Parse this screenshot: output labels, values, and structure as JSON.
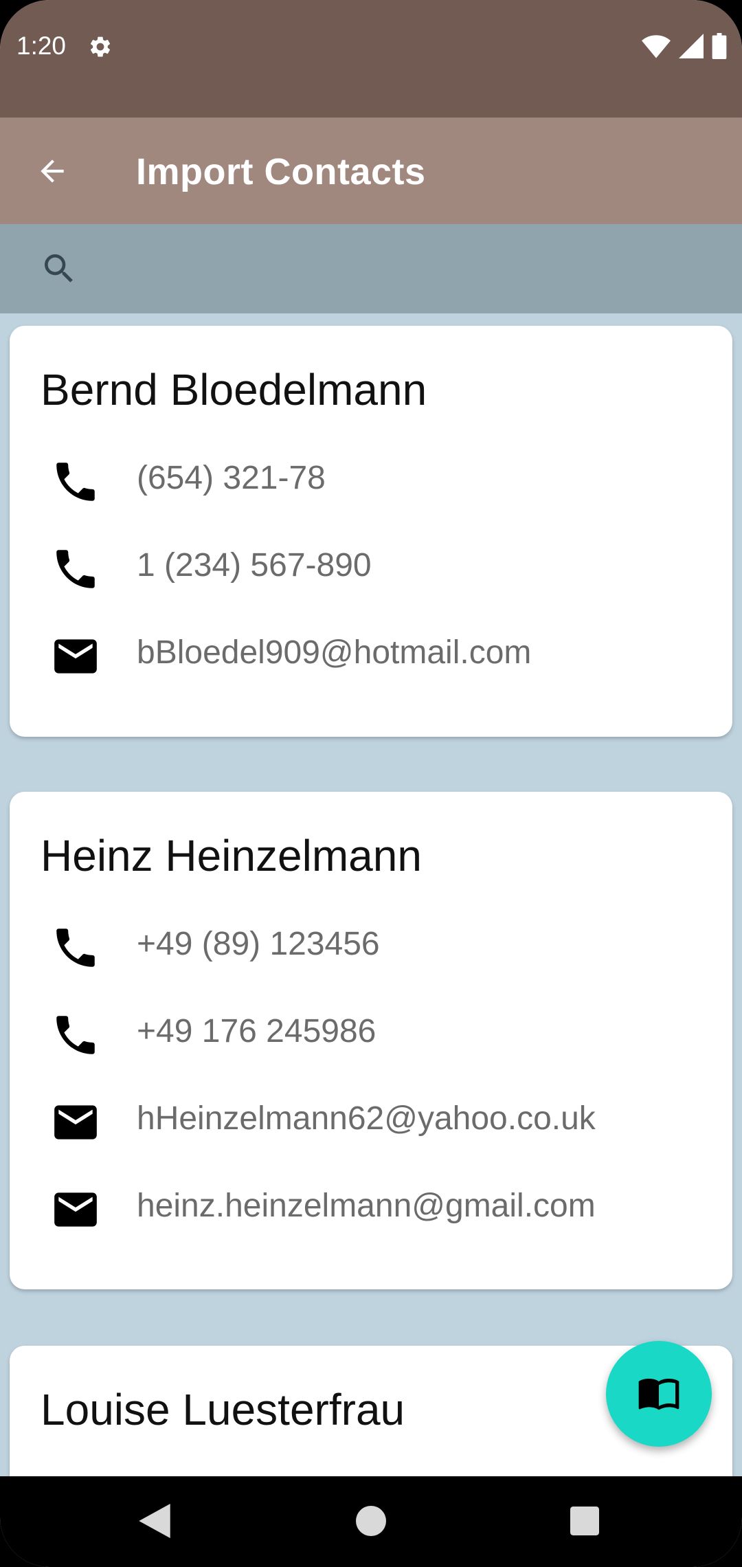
{
  "status_bar": {
    "time": "1:20",
    "icons": [
      "gear-icon",
      "wifi-icon",
      "signal-icon",
      "battery-icon"
    ]
  },
  "app_bar": {
    "title": "Import Contacts",
    "back_icon": "arrow-back-icon"
  },
  "search": {
    "icon": "search-icon",
    "value": "",
    "placeholder": ""
  },
  "contacts": [
    {
      "name": "Bernd Bloedelmann",
      "entries": [
        {
          "type": "phone",
          "value": "(654) 321-78"
        },
        {
          "type": "phone",
          "value": "1 (234) 567-890"
        },
        {
          "type": "email",
          "value": "bBloedel909@hotmail.com"
        }
      ]
    },
    {
      "name": "Heinz Heinzelmann",
      "entries": [
        {
          "type": "phone",
          "value": "+49 (89) 123456"
        },
        {
          "type": "phone",
          "value": "+49 176 245986"
        },
        {
          "type": "email",
          "value": "hHeinzelmann62@yahoo.co.uk"
        },
        {
          "type": "email",
          "value": "heinz.heinzelmann@gmail.com"
        }
      ]
    },
    {
      "name": "Louise Luesterfrau",
      "entries": []
    }
  ],
  "fab": {
    "icon": "book-open-icon"
  },
  "colors": {
    "status_bar": "#725b53",
    "app_bar": "#a1887f",
    "search_bar": "#8fa4ad",
    "background": "#bfd3df",
    "fab": "#1ad8c6"
  }
}
